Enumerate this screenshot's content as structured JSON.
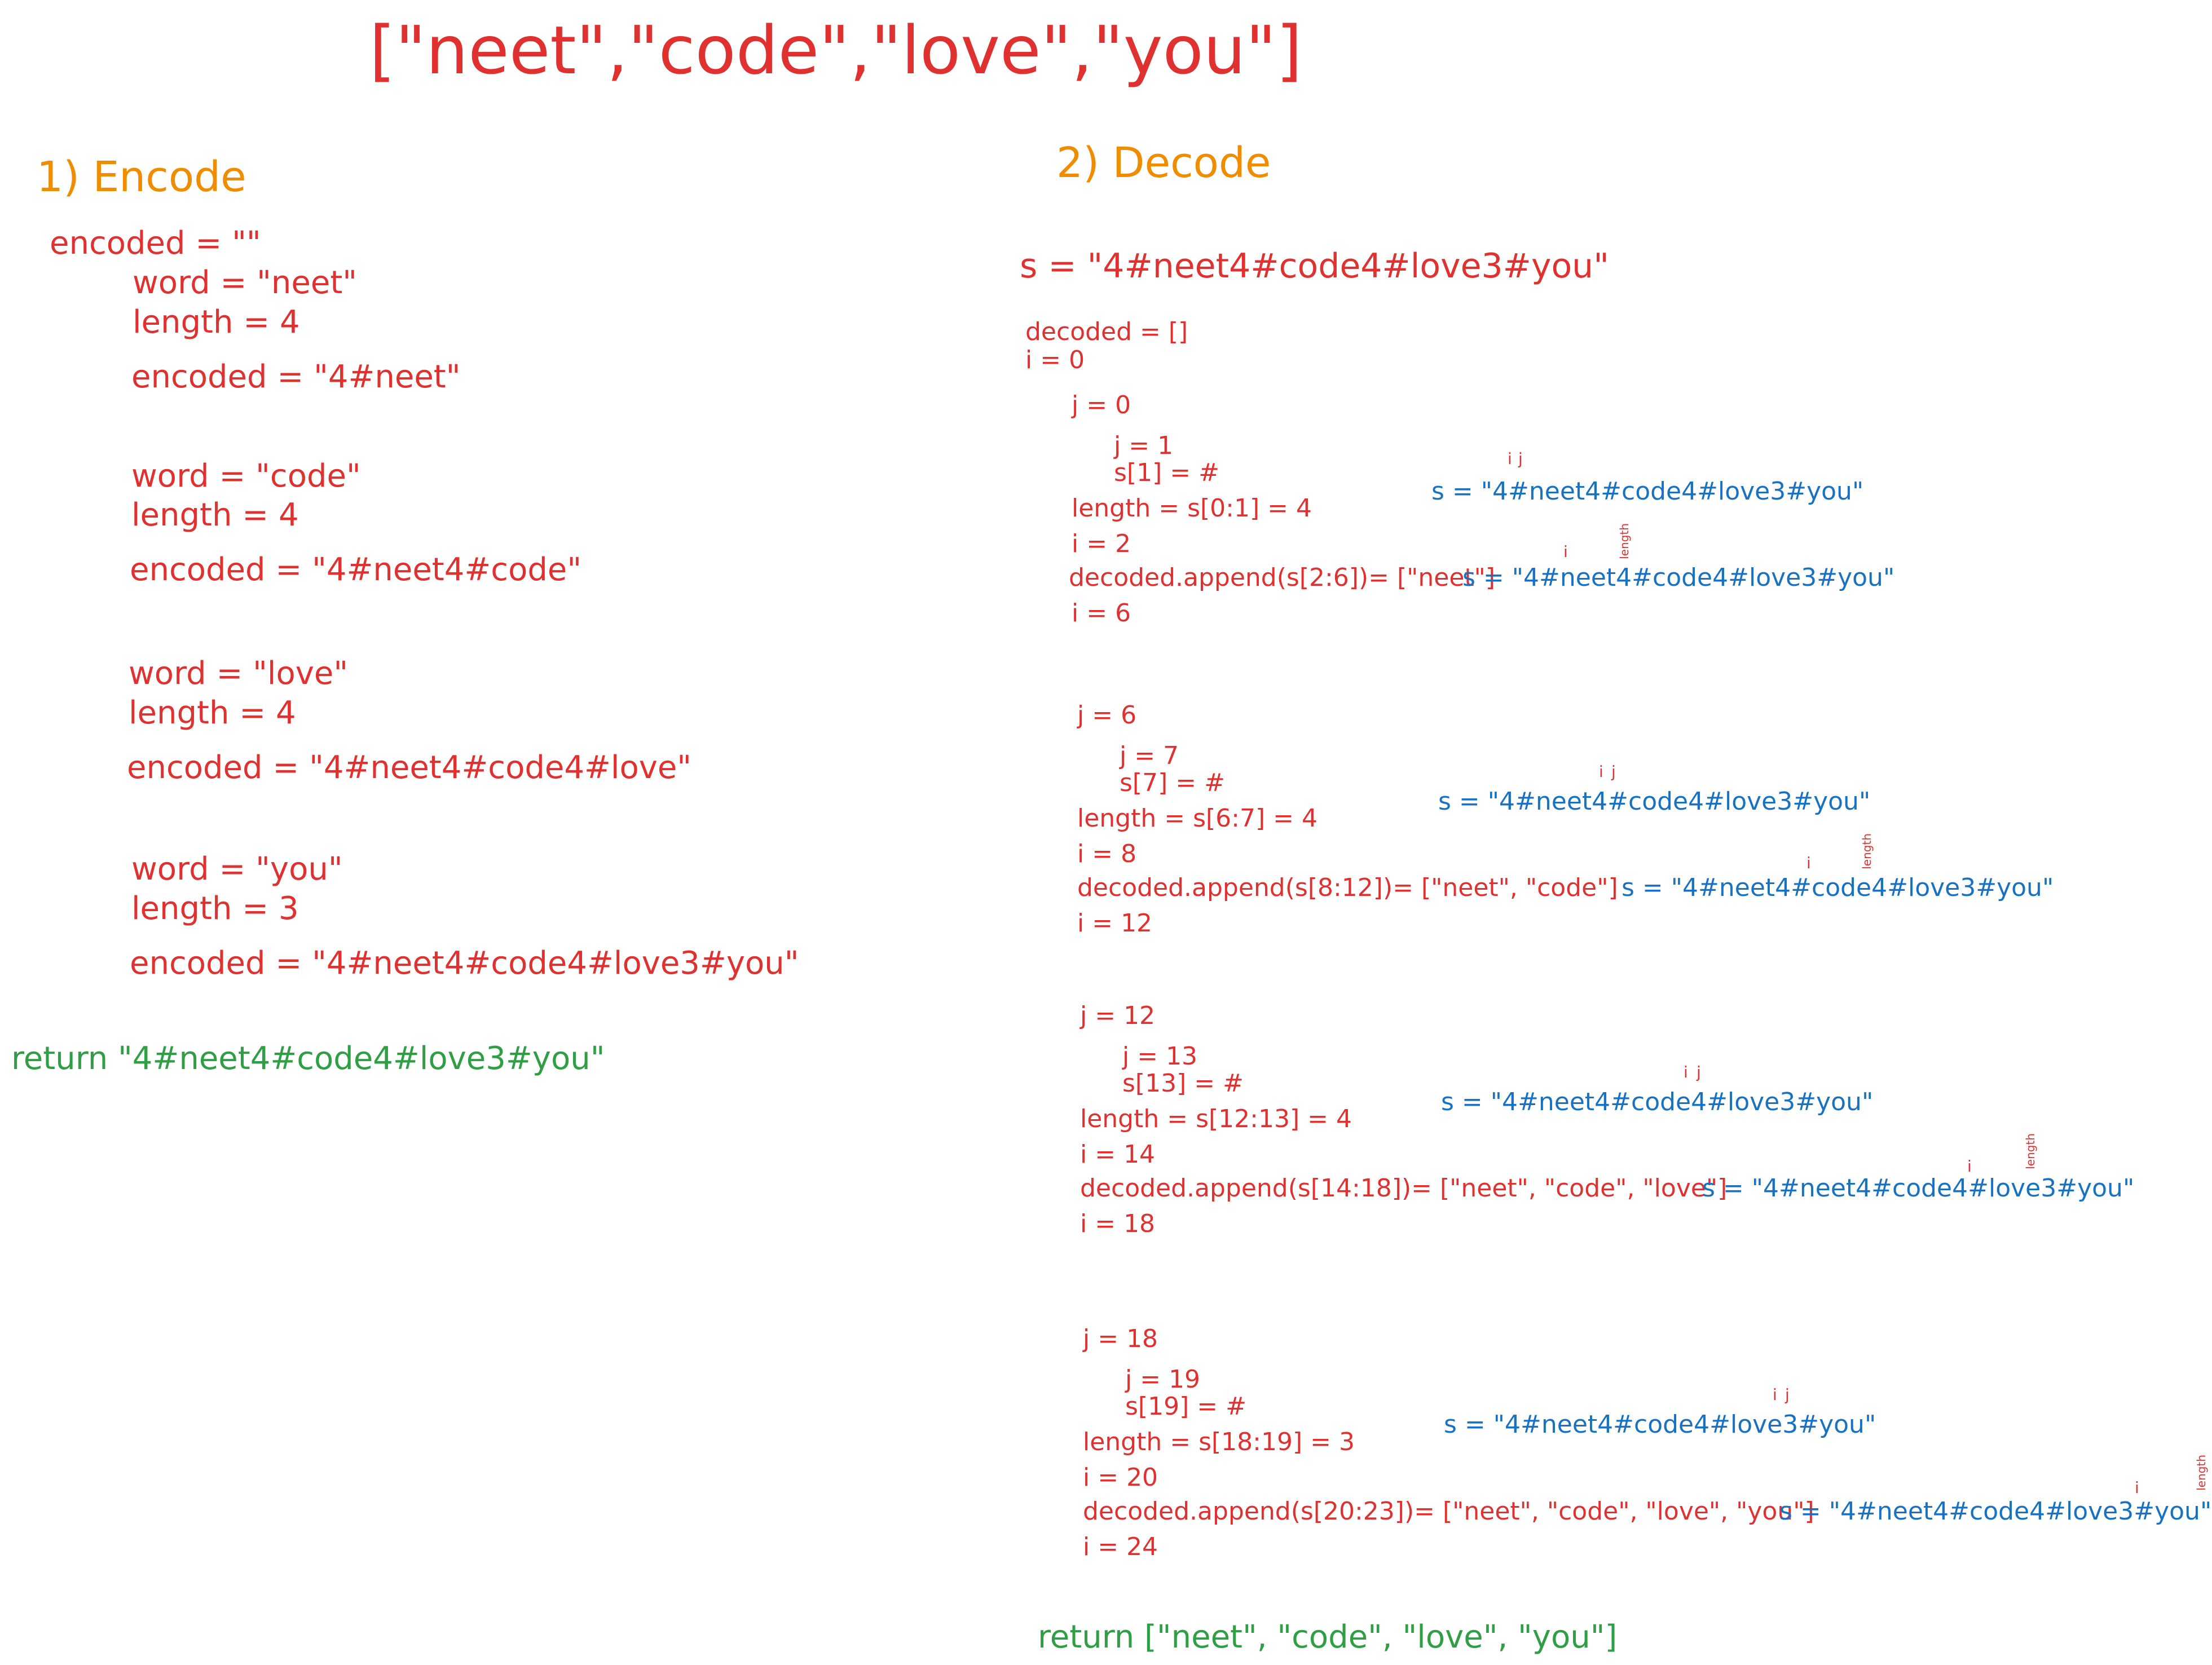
{
  "title": "[\"neet\",\"code\",\"love\",\"you\"]",
  "encode": {
    "heading": "1) Encode",
    "init": "encoded = \"\"",
    "steps": [
      {
        "word": "word = \"neet\"",
        "length": "length = 4",
        "encoded": "encoded = \"4#neet\""
      },
      {
        "word": "word = \"code\"",
        "length": "length = 4",
        "encoded": "encoded = \"4#neet4#code\""
      },
      {
        "word": "word = \"love\"",
        "length": "length = 4",
        "encoded": "encoded = \"4#neet4#code4#love\""
      },
      {
        "word": "word = \"you\"",
        "length": "length = 3",
        "encoded": "encoded = \"4#neet4#code4#love3#you\""
      }
    ],
    "return": "return \"4#neet4#code4#love3#you\""
  },
  "decode": {
    "heading": "2) Decode",
    "input": "s = \"4#neet4#code4#love3#you\"",
    "init_decoded": "decoded = []",
    "init_i": "i = 0",
    "blocks": [
      {
        "j_start": "j = 0",
        "j_next": "j = 1",
        "hash": "s[1] = #",
        "length": "length = s[0:1] = 4",
        "i_mid": "i = 2",
        "append": "decoded.append(s[2:6])= [\"neet\"]",
        "i_end": "i = 6",
        "s1": "s = \"4#neet4#code4#love3#you\"",
        "s2": "s = \"4#neet4#code4#love3#you\""
      },
      {
        "j_start": "j = 6",
        "j_next": "j = 7",
        "hash": "s[7] = #",
        "length": "length = s[6:7] = 4",
        "i_mid": "i = 8",
        "append": "decoded.append(s[8:12])= [\"neet\", \"code\"]",
        "i_end": "i = 12",
        "s1": "s = \"4#neet4#code4#love3#you\"",
        "s2": "s = \"4#neet4#code4#love3#you\""
      },
      {
        "j_start": "j = 12",
        "j_next": "j = 13",
        "hash": "s[13] = #",
        "length": "length = s[12:13] = 4",
        "i_mid": "i = 14",
        "append": "decoded.append(s[14:18])= [\"neet\", \"code\", \"love\"]",
        "i_end": "i = 18",
        "s1": "s = \"4#neet4#code4#love3#you\"",
        "s2": "s = \"4#neet4#code4#love3#you\""
      },
      {
        "j_start": "j = 18",
        "j_next": "j = 19",
        "hash": "s[19] = #",
        "length": "length = s[18:19] = 3",
        "i_mid": "i = 20",
        "append": "decoded.append(s[20:23])= [\"neet\", \"code\", \"love\", \"you\"]",
        "i_end": "i = 24",
        "s1": "s = \"4#neet4#code4#love3#you\"",
        "s2": "s = \"4#neet4#code4#love3#you\""
      }
    ],
    "return": "return [\"neet\", \"code\", \"love\", \"you\"]",
    "pointer_i": "i",
    "pointer_j": "j",
    "pointer_length": "length"
  },
  "colors": {
    "red": "#e03131",
    "orange": "#f08c00",
    "green": "#2f9e44",
    "blue": "#1971c2"
  }
}
